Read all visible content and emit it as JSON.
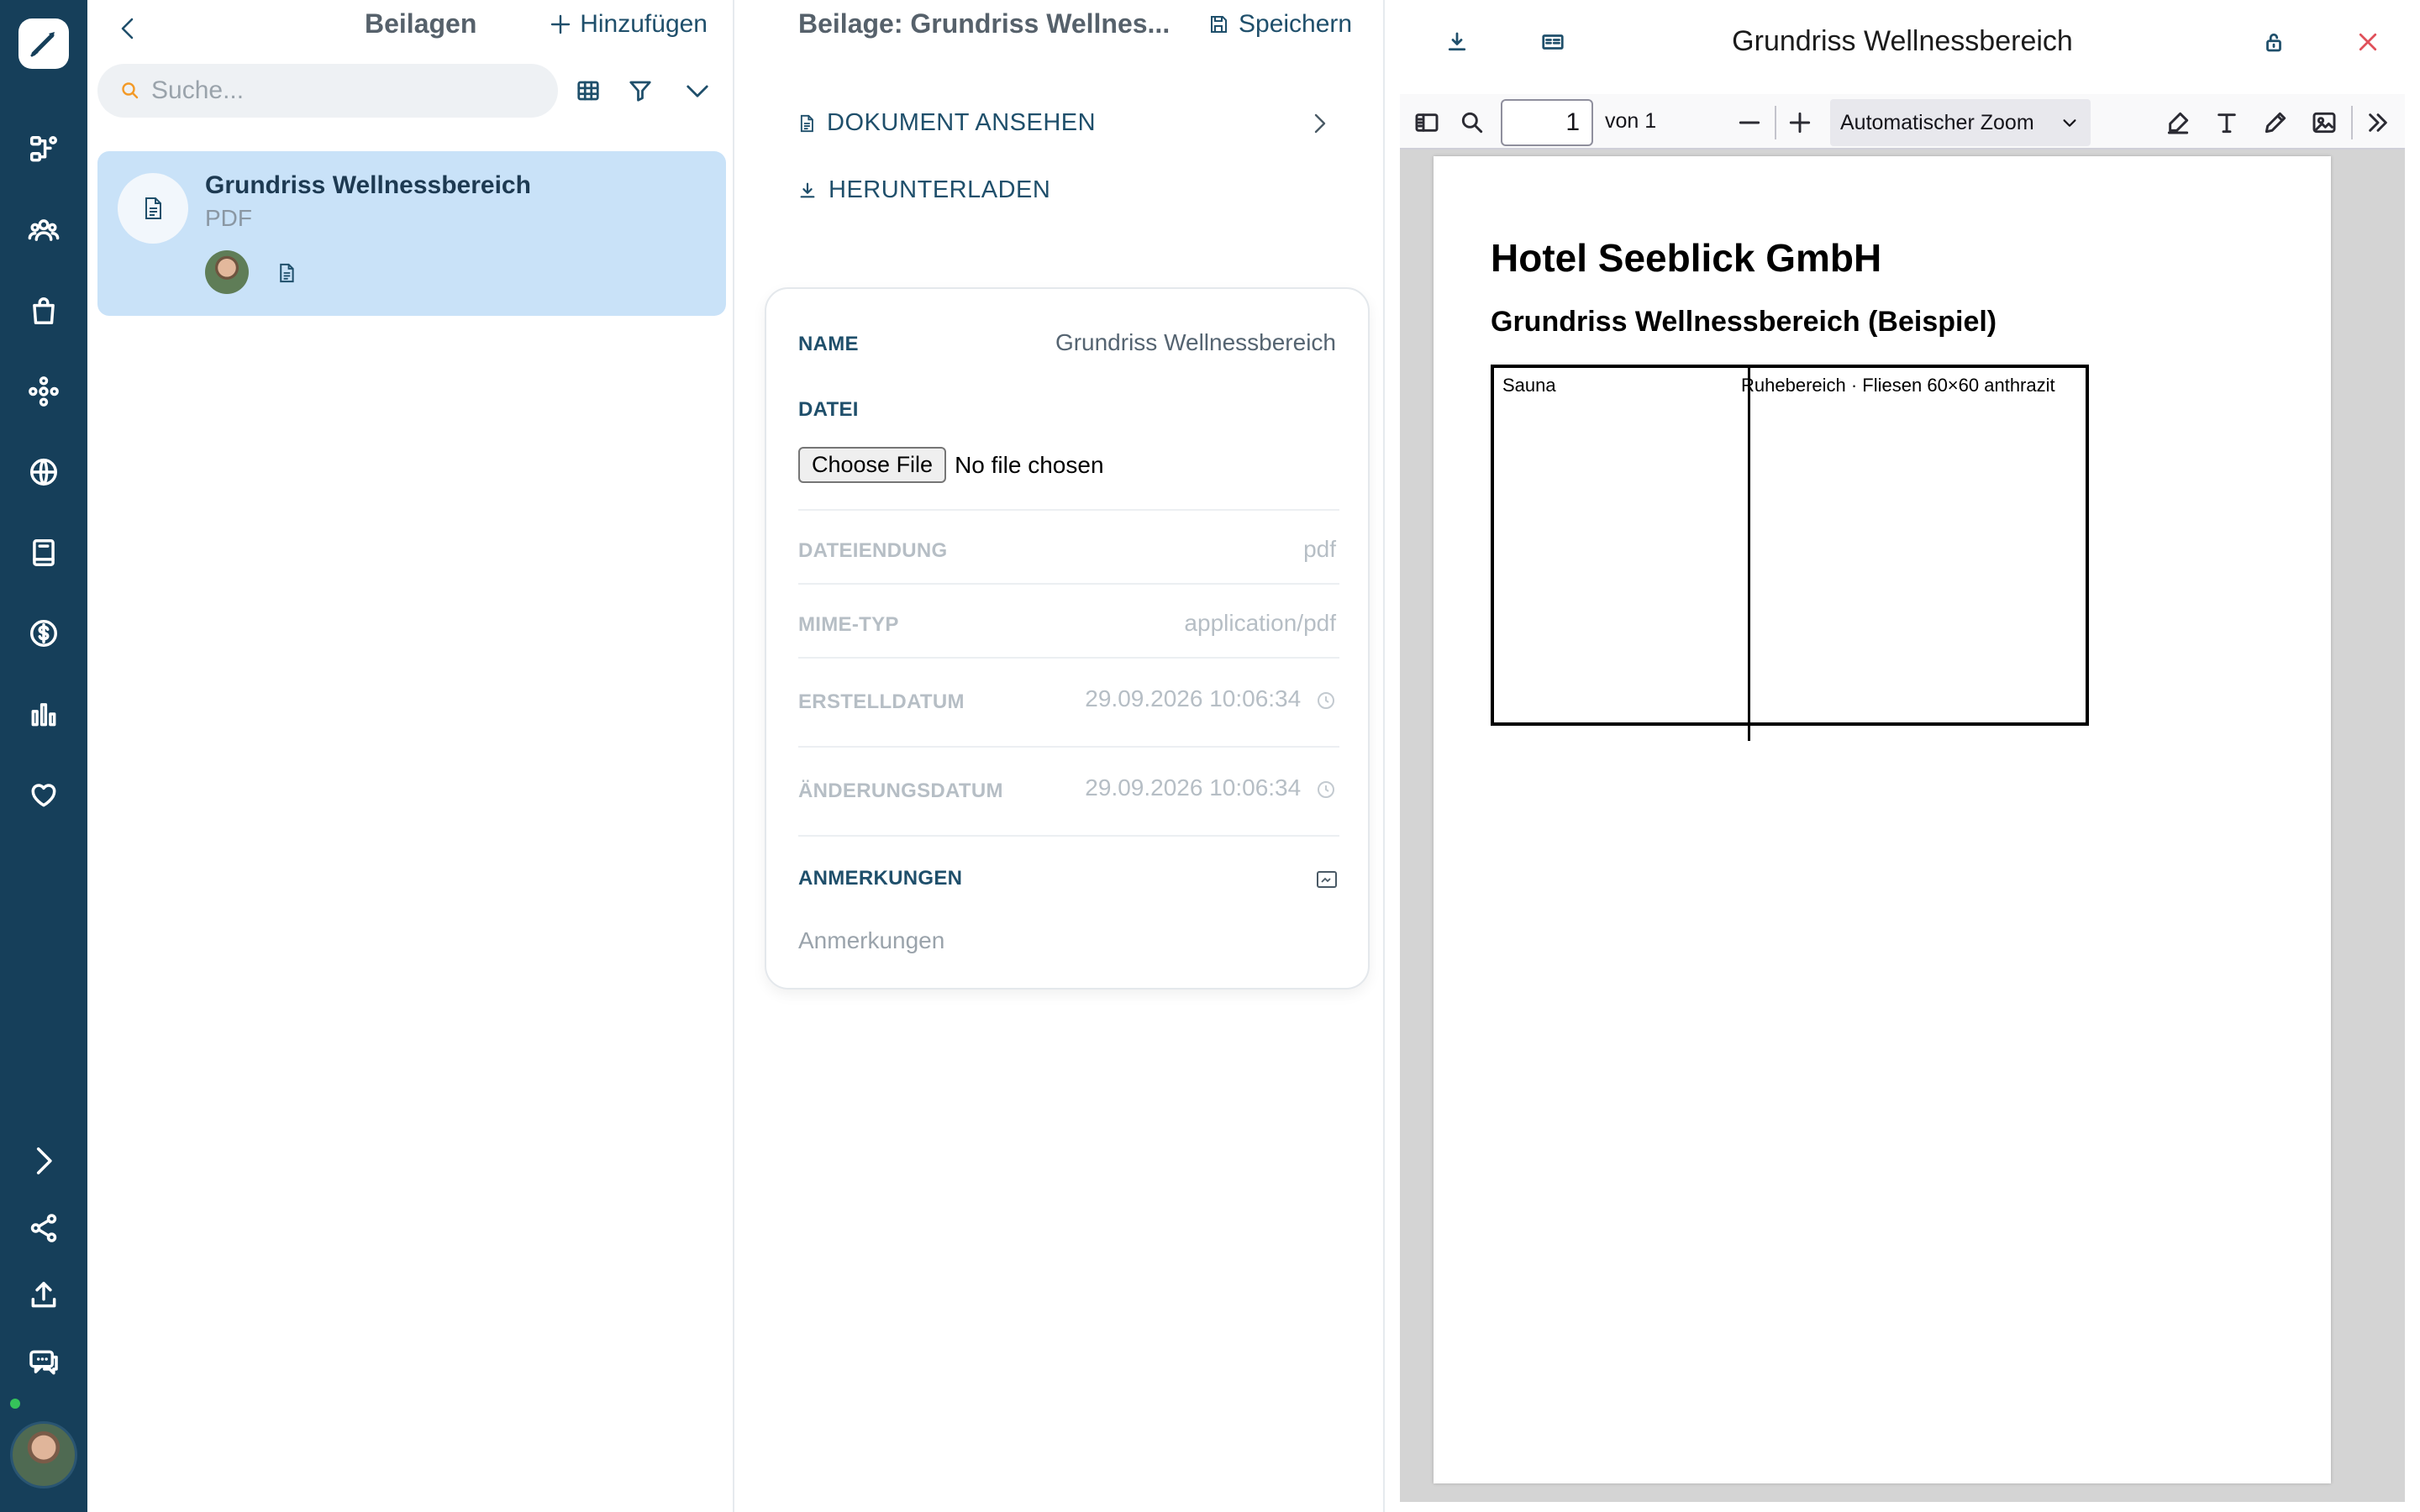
{
  "colors": {
    "rail": "#163f5a",
    "accent": "#1f4f6b",
    "selected_item": "#c9e2f8",
    "online": "#35c25a",
    "close": "#e0505a"
  },
  "rail": {
    "icons": [
      "logo-icon",
      "hierarchy-icon",
      "users-icon",
      "shopping-bag-icon",
      "network-icon",
      "globe-icon",
      "book-icon",
      "dollar-icon",
      "bar-chart-icon",
      "heart-icon",
      "expand-icon",
      "share-icon",
      "upload-icon",
      "chat-icon"
    ]
  },
  "list": {
    "title": "Beilagen",
    "add_label": "Hinzufügen",
    "search_placeholder": "Suche...",
    "items": [
      {
        "name": "Grundriss Wellnessbereich",
        "type": "PDF"
      }
    ]
  },
  "detail": {
    "title": "Beilage: Grundriss Wellnes...",
    "save_label": "Speichern",
    "view_doc_label": "DOKUMENT ANSEHEN",
    "download_label": "HERUNTERLADEN",
    "fields": {
      "name_label": "NAME",
      "name_value": "Grundriss Wellnessbereich",
      "file_label": "DATEI",
      "choose_file": "Choose File",
      "no_file": "No file chosen",
      "ext_label": "DATEIENDUNG",
      "ext_value": "pdf",
      "mime_label": "MIME-TYP",
      "mime_value": "application/pdf",
      "created_label": "ERSTELLDATUM",
      "created_value": "29.09.2026 10:06:34",
      "modified_label": "ÄNDERUNGSDATUM",
      "modified_value": "29.09.2026 10:06:34",
      "notes_label": "ANMERKUNGEN",
      "notes_placeholder": "Anmerkungen"
    }
  },
  "viewer": {
    "title": "Grundriss Wellnessbereich",
    "toolbar": {
      "page": "1",
      "of_label": "von 1",
      "zoom": "Automatischer Zoom"
    },
    "document": {
      "heading": "Hotel Seeblick GmbH",
      "subheading": "Grundriss Wellnessbereich (Beispiel)",
      "room_left": "Sauna",
      "room_right": "Ruhebereich · Fliesen 60×60 anthrazit"
    }
  }
}
